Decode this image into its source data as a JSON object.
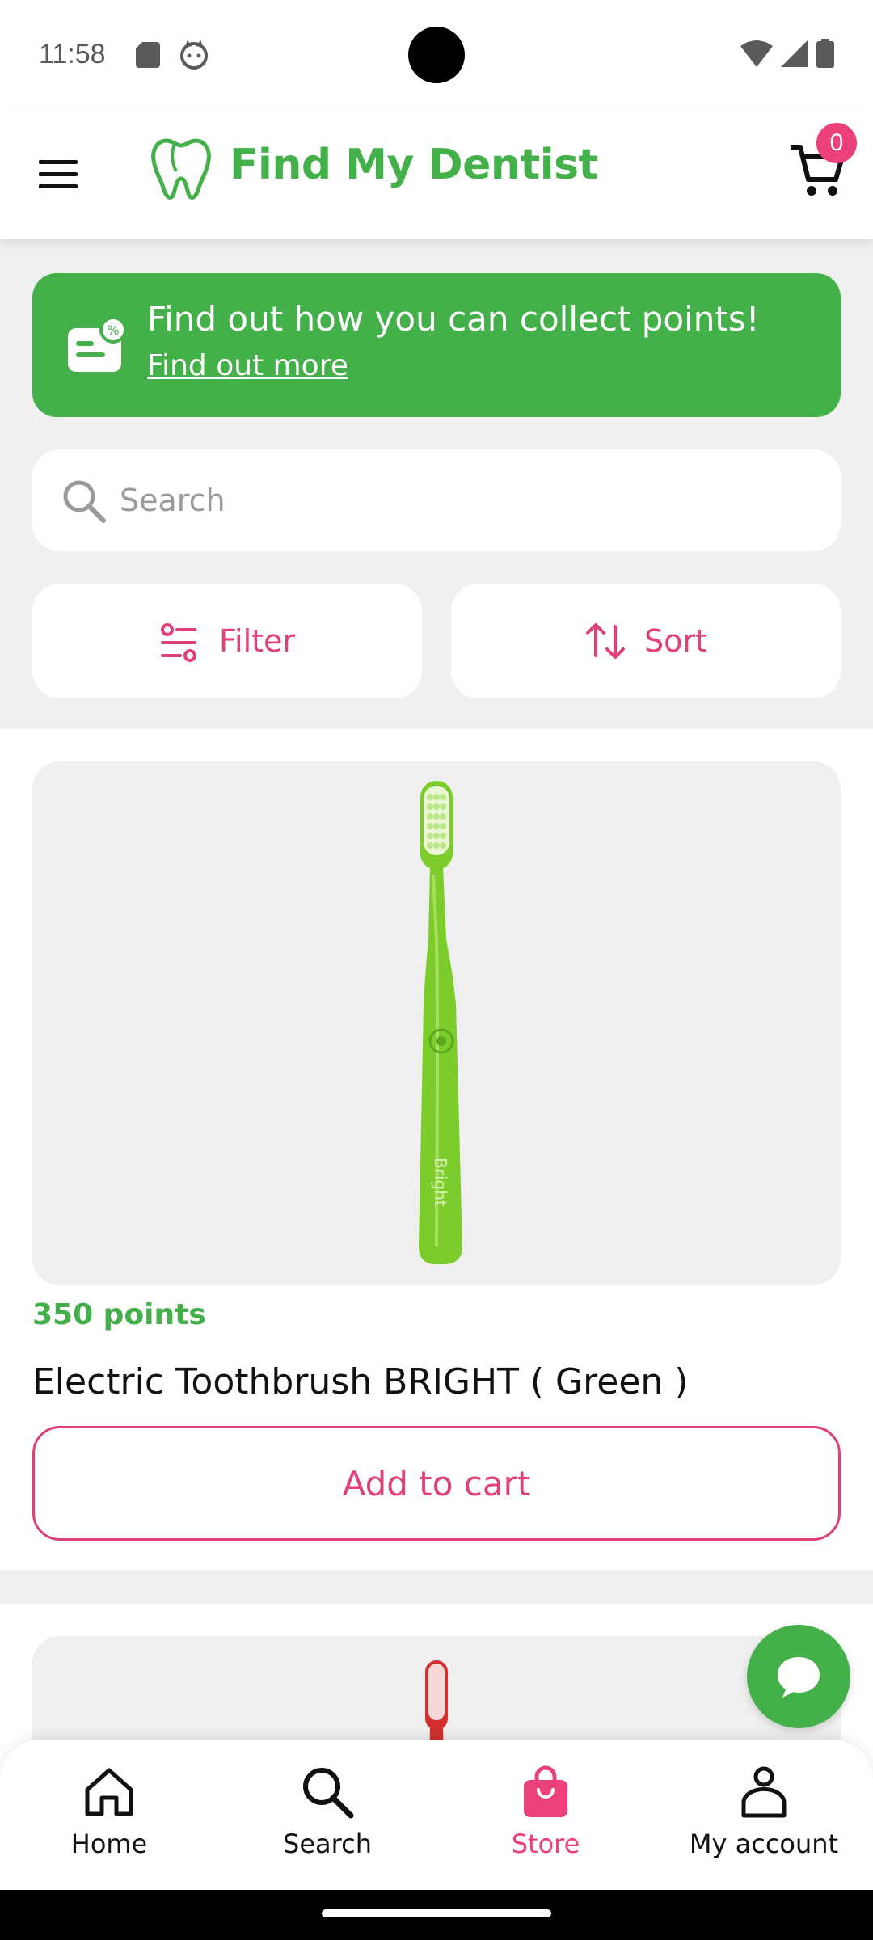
{
  "status_bar": {
    "time": "11:58"
  },
  "header": {
    "brand": "Find My Dentist",
    "cart_count": "0"
  },
  "promo": {
    "title": "Find out how you can collect points!",
    "link": "Find out more"
  },
  "search": {
    "placeholder": "Search"
  },
  "toolbar": {
    "filter_label": "Filter",
    "sort_label": "Sort"
  },
  "products": [
    {
      "points": "350 points",
      "name": "Electric Toothbrush BRIGHT ( Green )",
      "add_label": "Add to cart",
      "image_label": "Bright"
    }
  ],
  "bottom_nav": {
    "items": [
      {
        "label": "Home",
        "icon": "home-icon"
      },
      {
        "label": "Search",
        "icon": "search-icon"
      },
      {
        "label": "Store",
        "icon": "shopping-bag-icon",
        "active": true
      },
      {
        "label": "My account",
        "icon": "account-icon"
      }
    ]
  },
  "colors": {
    "brand_green": "#43b04a",
    "accent_pink": "#e0407a"
  }
}
